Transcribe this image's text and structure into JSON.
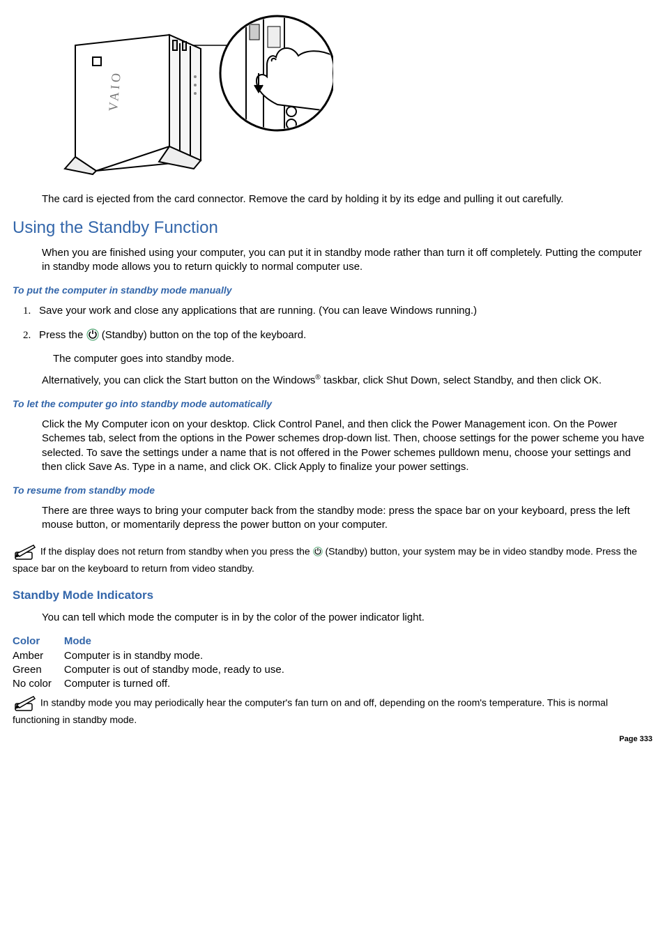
{
  "illustration_alt": "Illustration of a VAIO desktop tower with a zoom-in callout showing a finger pressing an eject button above card slots on the front panel.",
  "para_eject": "The card is ejected from the card connector. Remove the card by holding it by its edge and pulling it out carefully.",
  "section_standby_title": "Using the Standby Function",
  "para_standby_intro": "When you are finished using your computer, you can put it in standby mode rather than turn it off completely. Putting the computer in standby mode allows you to return quickly to normal computer use.",
  "subhead_manual": "To put the computer in standby mode manually",
  "steps": {
    "s1": "Save your work and close any applications that are running. (You can leave Windows running.)",
    "s2_pre": "Press the ",
    "s2_post": "(Standby) button on the top of the keyboard.",
    "s2_sub": "The computer goes into standby mode."
  },
  "para_alt_pre": "Alternatively, you can click the Start button on the Windows",
  "para_alt_post": " taskbar, click Shut Down, select Standby, and then click OK.",
  "subhead_auto": "To let the computer go into standby mode automatically",
  "para_auto": "Click the My Computer icon on your desktop. Click Control Panel, and then click the Power Management icon. On the Power Schemes tab, select from the options in the Power schemes drop-down list. Then, choose settings for the power scheme you have selected. To save the settings under a name that is not offered in the Power schemes pulldown menu, choose your settings and then click Save As. Type in a name, and click OK. Click Apply to finalize your power settings.",
  "subhead_resume": "To resume from standby mode",
  "para_resume": "There are three ways to bring your computer back from the standby mode: press the space bar on your keyboard, press the left mouse button, or momentarily depress the power button on your computer.",
  "note1_pre": " If the display does not return from standby when you press the ",
  "note1_post": "(Standby) button, your system may be in video standby mode. Press the space bar on the keyboard to return from video standby.",
  "h3_indicators": "Standby Mode Indicators",
  "para_indicators": "You can tell which mode the computer is in by the color of the power indicator light.",
  "table": {
    "head_color": "Color",
    "head_mode": "Mode",
    "rows": [
      {
        "color": "Amber",
        "mode": "Computer is in standby mode."
      },
      {
        "color": "Green",
        "mode": "Computer is out of standby mode, ready to use."
      },
      {
        "color": "No color",
        "mode": "Computer is turned off."
      }
    ]
  },
  "note2": " In standby mode you may periodically hear the computer's fan turn on and off, depending on the room's temperature. This is normal functioning in standby mode.",
  "page_label": "Page 333"
}
